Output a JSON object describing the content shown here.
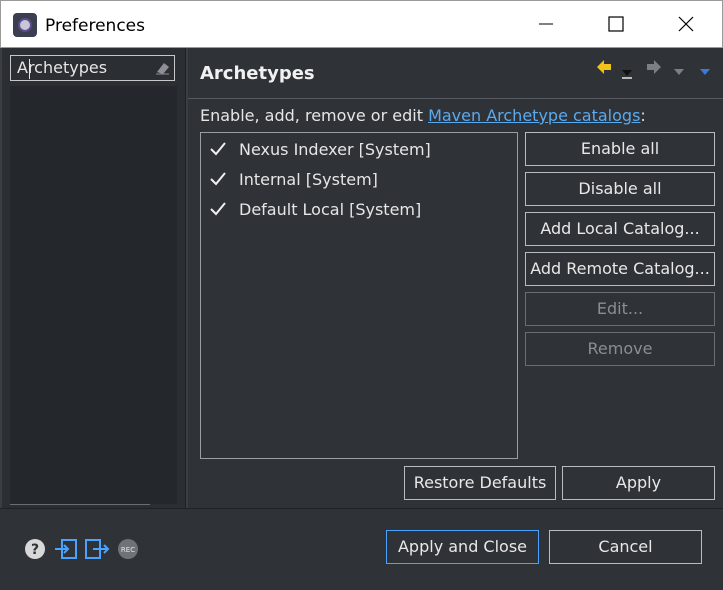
{
  "window": {
    "title": "Preferences"
  },
  "filter": {
    "value": "Archetypes"
  },
  "page": {
    "title": "Archetypes",
    "description_prefix": "Enable, add, remove or edit ",
    "description_link": "Maven Archetype catalogs",
    "description_suffix": ":"
  },
  "catalogs": [
    {
      "label": "Nexus Indexer [System]",
      "checked": true
    },
    {
      "label": "Internal [System]",
      "checked": true
    },
    {
      "label": "Default Local [System]",
      "checked": true
    }
  ],
  "side_buttons": {
    "enable_all": "Enable all",
    "disable_all": "Disable all",
    "add_local": "Add Local Catalog...",
    "add_remote": "Add Remote Catalog...",
    "edit": "Edit...",
    "remove": "Remove"
  },
  "page_buttons": {
    "restore_defaults": "Restore Defaults",
    "apply": "Apply"
  },
  "dialog_buttons": {
    "apply_and_close": "Apply and Close",
    "cancel": "Cancel"
  },
  "footer": {
    "rec_label": "REC"
  },
  "colors": {
    "accent": "#4aa3ff",
    "link": "#5aaaf0",
    "back_arrow": "#f2c21b",
    "menu_arrow": "#3a7bd5"
  }
}
